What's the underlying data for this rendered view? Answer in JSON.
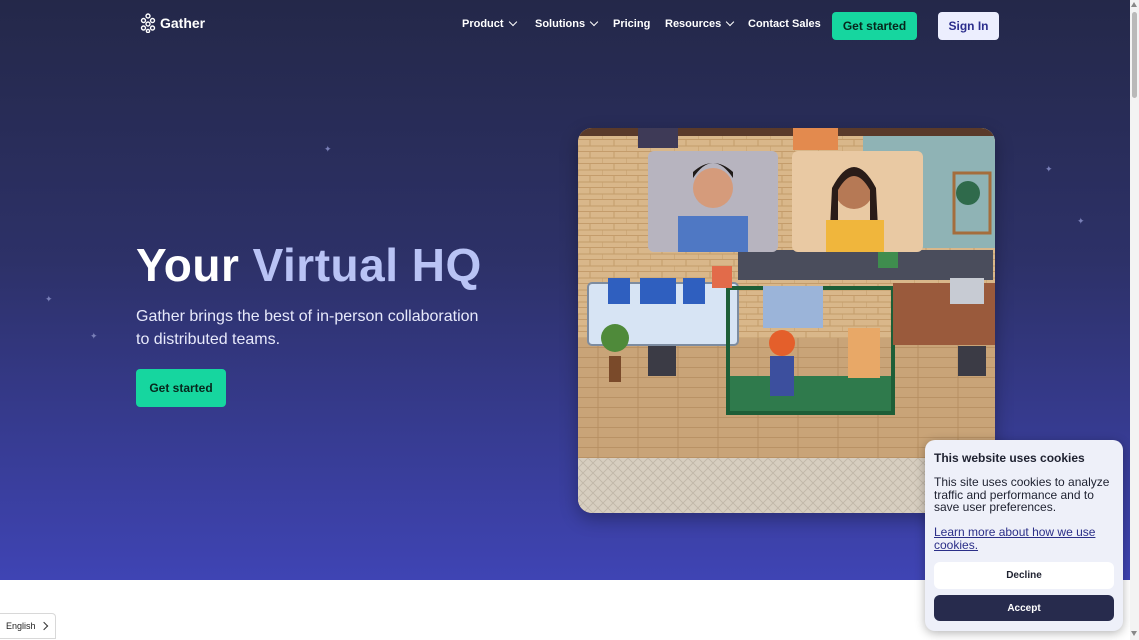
{
  "brand": {
    "name": "Gather"
  },
  "nav": {
    "items": [
      {
        "label": "Product",
        "has_dropdown": true
      },
      {
        "label": "Solutions",
        "has_dropdown": true
      },
      {
        "label": "Pricing",
        "has_dropdown": false
      },
      {
        "label": "Resources",
        "has_dropdown": true
      },
      {
        "label": "Contact Sales",
        "has_dropdown": false
      }
    ],
    "cta_label": "Get started",
    "signin_label": "Sign In"
  },
  "hero": {
    "title_part1": "Your ",
    "title_part2": "Virtual HQ",
    "subtitle": "Gather brings the best of in-person collaboration to distributed teams.",
    "cta_label": "Get started",
    "image_icon": "virtual-office-pixel-art-with-video-call-tiles"
  },
  "cookie_banner": {
    "title": "This website uses cookies",
    "text": "This site uses cookies to analyze traffic and performance and to save user preferences.",
    "link": "Learn more about how we use cookies.",
    "decline_label": "Decline",
    "accept_label": "Accept"
  },
  "language_selector": {
    "value": "English"
  },
  "colors": {
    "accent_green": "#16d69f",
    "hero_top": "#242849",
    "hero_bottom": "#3f44b4",
    "title_accent": "#b9c3f5",
    "accept_button": "#272b4d"
  }
}
